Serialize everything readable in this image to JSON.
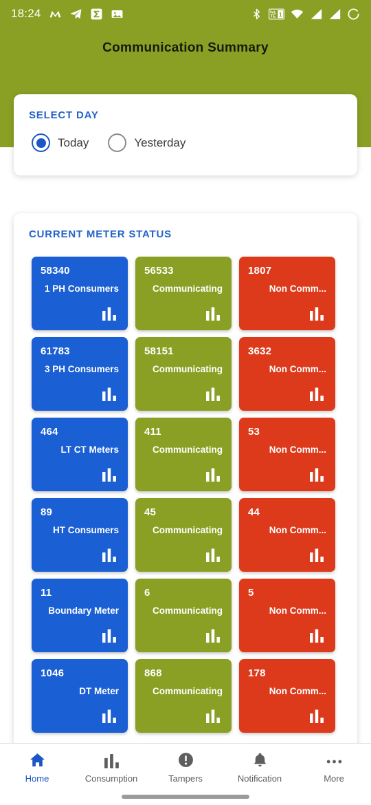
{
  "statusbar": {
    "time": "18:24",
    "left_icons": [
      "m-app-icon",
      "telegram-send-icon",
      "sigma-app-icon",
      "photo-gallery-icon"
    ],
    "right_icons": [
      "bluetooth-icon",
      "volte-icon",
      "wifi-icon",
      "signal-bars-icon",
      "signal-bars-2-icon",
      "battery-circle-icon"
    ]
  },
  "header": {
    "title": "Communication Summary",
    "background_color": "#8aa024",
    "title_color": "#17190d"
  },
  "select_day": {
    "heading": "SELECT DAY",
    "options": [
      {
        "label": "Today",
        "selected": true
      },
      {
        "label": "Yesterday",
        "selected": false
      }
    ],
    "accent_color": "#1a56c4"
  },
  "meter_status": {
    "heading": "CURRENT METER STATUS",
    "colors": {
      "total": "#1a5fd4",
      "communicating": "#8aa024",
      "non_communicating": "#dd3a1c"
    },
    "rows": [
      {
        "total": {
          "value": "58340",
          "label": "1 PH Consumers"
        },
        "comm": {
          "value": "56533",
          "label": "Communicating"
        },
        "noncomm": {
          "value": "1807",
          "label": "Non Comm..."
        }
      },
      {
        "total": {
          "value": "61783",
          "label": "3 PH Consumers"
        },
        "comm": {
          "value": "58151",
          "label": "Communicating"
        },
        "noncomm": {
          "value": "3632",
          "label": "Non Comm..."
        }
      },
      {
        "total": {
          "value": "464",
          "label": "LT CT Meters"
        },
        "comm": {
          "value": "411",
          "label": "Communicating"
        },
        "noncomm": {
          "value": "53",
          "label": "Non Comm..."
        }
      },
      {
        "total": {
          "value": "89",
          "label": "HT Consumers"
        },
        "comm": {
          "value": "45",
          "label": "Communicating"
        },
        "noncomm": {
          "value": "44",
          "label": "Non Comm..."
        }
      },
      {
        "total": {
          "value": "11",
          "label": "Boundary Meter"
        },
        "comm": {
          "value": "6",
          "label": "Communicating"
        },
        "noncomm": {
          "value": "5",
          "label": "Non Comm..."
        }
      },
      {
        "total": {
          "value": "1046",
          "label": "DT Meter"
        },
        "comm": {
          "value": "868",
          "label": "Communicating"
        },
        "noncomm": {
          "value": "178",
          "label": "Non Comm..."
        }
      }
    ]
  },
  "bottom_nav": {
    "items": [
      {
        "label": "Home",
        "icon": "home-icon",
        "active": true
      },
      {
        "label": "Consumption",
        "icon": "bar-chart-icon",
        "active": false
      },
      {
        "label": "Tampers",
        "icon": "alert-circle-icon",
        "active": false
      },
      {
        "label": "Notification",
        "icon": "bell-icon",
        "active": false
      },
      {
        "label": "More",
        "icon": "ellipsis-icon",
        "active": false
      }
    ],
    "active_color": "#1a56c4",
    "inactive_color": "#5e5e5e"
  }
}
